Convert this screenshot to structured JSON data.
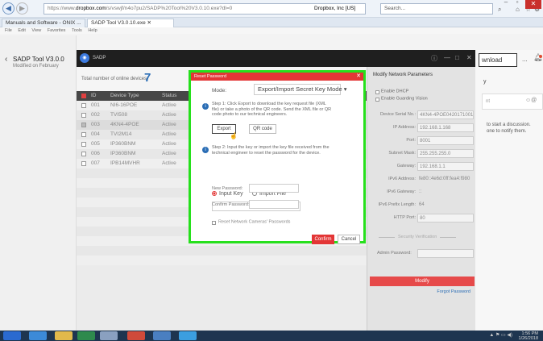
{
  "browser": {
    "url_prefix": "https://www.",
    "url_domain": "dropbox.com",
    "url_rest": "/s/vswjf/n4o7pu2/SADP%20Tool%20V3.0.10.exe?dl=0",
    "cert": "Dropbox, Inc [US]",
    "search_placeholder": "Search...",
    "back_icon": "back-arrow-icon",
    "tabs": [
      {
        "label": "Manuals and Software - ONIX ..."
      },
      {
        "label": "SADP Tool V3.0.10.exe"
      }
    ],
    "menus": [
      "File",
      "Edit",
      "View",
      "Favorites",
      "Tools",
      "Help"
    ]
  },
  "left_panel": {
    "title": "SADP Tool V3.0.0",
    "subtitle": "Modified on February"
  },
  "right_panel": {
    "download_label": "wnload",
    "more_label": "...",
    "y_label": "y",
    "t1": "to start a discussion.",
    "t2": "one to notify them."
  },
  "sadp": {
    "app_name": "SADP",
    "online_label": "Total number of online devices:",
    "online_count": "7",
    "columns": [
      "ID",
      "Device Type",
      "Status"
    ],
    "rows": [
      {
        "id": "001",
        "type": "NI6-16POE",
        "status": "Active"
      },
      {
        "id": "002",
        "type": "TVI508",
        "status": "Active"
      },
      {
        "id": "003",
        "type": "4KN4-4POE",
        "status": "Active"
      },
      {
        "id": "004",
        "type": "TVI2M14",
        "status": "Active"
      },
      {
        "id": "005",
        "type": "IP360BNM",
        "status": "Active"
      },
      {
        "id": "006",
        "type": "IP360BNM",
        "status": "Active"
      },
      {
        "id": "007",
        "type": "IPB14MVHR",
        "status": "Active"
      }
    ]
  },
  "modify": {
    "header": "Modify Network Parameters",
    "enable_dhcp": "Enable DHCP",
    "enable_guarding": "Enable Guarding Vision",
    "params": [
      {
        "k": "Device Serial No.:",
        "v": "4KN4-4POE0420171001CC"
      },
      {
        "k": "IP Address:",
        "v": "192.168.1.168"
      },
      {
        "k": "Port:",
        "v": "8001"
      },
      {
        "k": "Subnet Mask:",
        "v": "255.255.255.0"
      },
      {
        "k": "Gateway:",
        "v": "192.168.1.1"
      },
      {
        "k": "IPv6 Address:",
        "v": "fe80::4e6d:0ff:fea4:f980"
      },
      {
        "k": "IPv6 Gateway:",
        "v": "::"
      },
      {
        "k": "IPv6 Prefix Length:",
        "v": "64"
      },
      {
        "k": "HTTP Port:",
        "v": "80"
      }
    ],
    "security_title": "Security Verification",
    "admin_password": "Admin Password:",
    "modify_button": "Modify",
    "forgot": "Forgot Password"
  },
  "modal": {
    "title": "Reset Password",
    "mode_label": "Mode:",
    "mode_value": "Export/Import Secret Key Mode",
    "step1": "Step 1: Click Export to download the key request file (XML file) or take a photo of the QR code. Send the XML file or QR code photo to our technical engineers.",
    "export_label": "Export",
    "qr_label": "QR code",
    "step2": "Step 2: Input the key or import the key file received from the technical engineer to reset the password for the device.",
    "input_key": "Input Key",
    "import_file": "Import File",
    "new_password": "New Password:",
    "confirm_password": "Confirm Password:",
    "reset_network": "Reset Network Cameras' Passwords",
    "confirm_btn": "Confirm",
    "cancel_btn": "Cancel"
  },
  "taskbar": {
    "time": "1:56 PM",
    "date": "1/26/2018"
  },
  "colors": {
    "accent": "#e33636",
    "highlight": "#26e01c",
    "link": "#2a6db5"
  }
}
